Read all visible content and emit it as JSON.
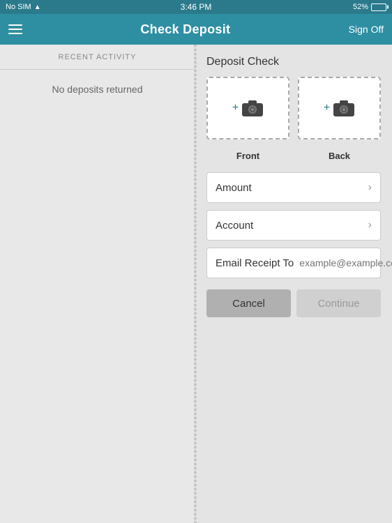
{
  "statusBar": {
    "carrier": "No SIM",
    "wifi": "📶",
    "time": "3:46 PM",
    "battery_pct": "52%"
  },
  "navBar": {
    "title": "Check Deposit",
    "signoff_label": "Sign Off"
  },
  "leftPanel": {
    "recent_activity_label": "RECENT ACTIVITY",
    "no_deposits_label": "No deposits returned"
  },
  "rightPanel": {
    "deposit_check_title": "Deposit Check",
    "front_label": "Front",
    "back_label": "Back",
    "amount_label": "Amount",
    "account_label": "Account",
    "email_receipt_label": "Email Receipt To",
    "email_placeholder": "example@example.com",
    "cancel_label": "Cancel",
    "continue_label": "Continue"
  }
}
